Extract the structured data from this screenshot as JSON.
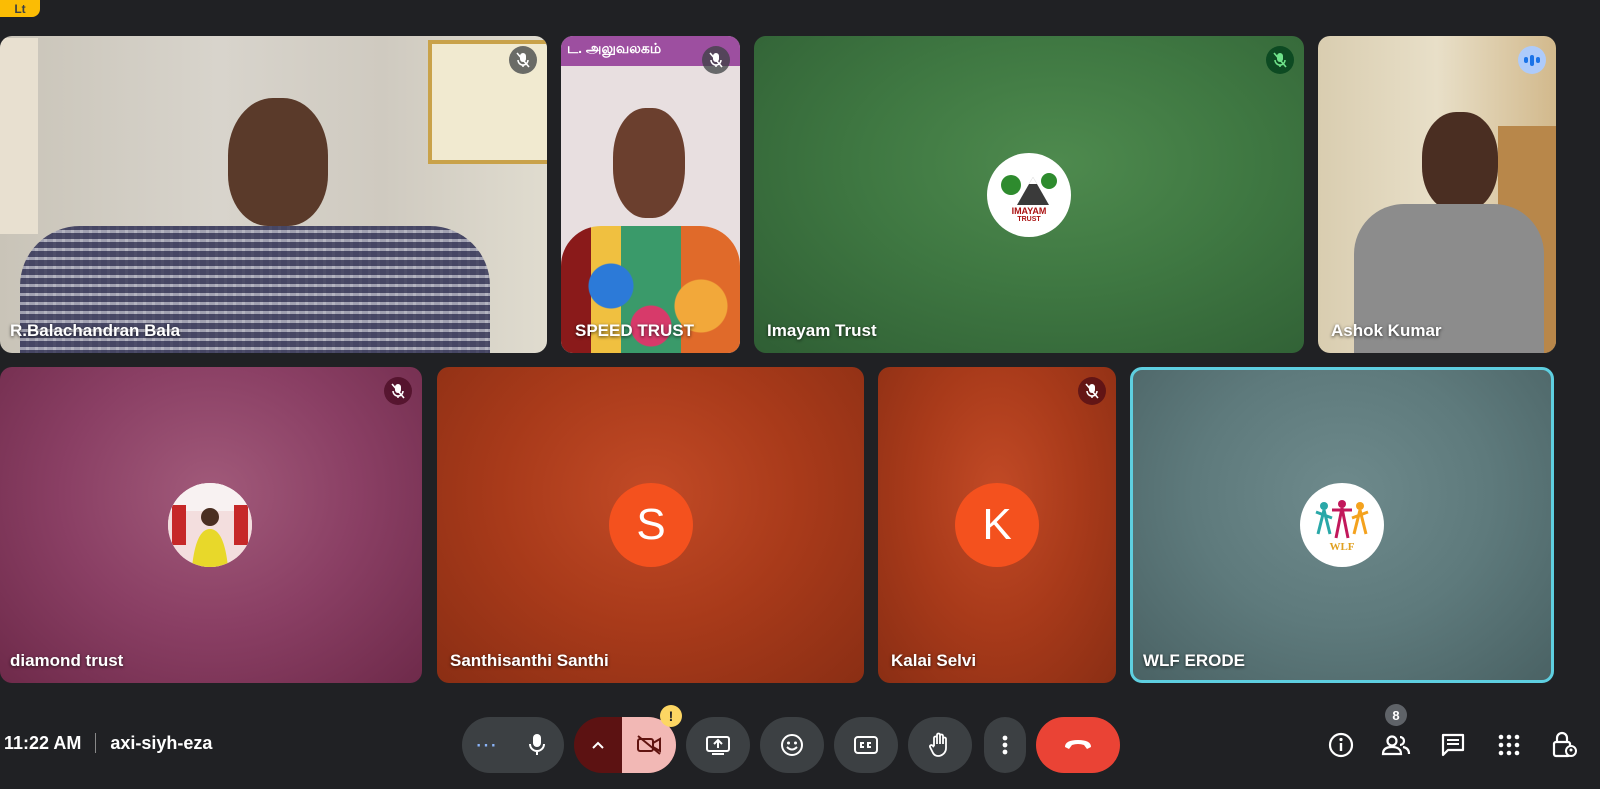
{
  "meeting": {
    "time": "11:22 AM",
    "code": "axi-siyh-eza",
    "participant_count": "8",
    "top_badge": "Lt"
  },
  "tiles": {
    "t1": {
      "name": "R.Balachandran Bala",
      "mic": "muted"
    },
    "t2": {
      "name": "SPEED TRUST",
      "mic": "muted",
      "banner_text": "ட. அலுவலகம்"
    },
    "t3": {
      "name": "Imayam Trust",
      "mic": "muted",
      "logo_text": "IMAYAM",
      "logo_subtext": "TRUST"
    },
    "t4": {
      "name": "Ashok Kumar",
      "mic": "speaking"
    },
    "t5": {
      "name": "diamond trust",
      "mic": "muted"
    },
    "t6": {
      "name": "Santhisanthi Santhi",
      "initial": "S"
    },
    "t7": {
      "name": "Kalai Selvi",
      "mic": "muted",
      "initial": "K"
    },
    "t8": {
      "name": "WLF ERODE",
      "logo_text": "WLF",
      "pinned": true
    }
  },
  "controls": {
    "more_label": "⋯",
    "alert_label": "!"
  },
  "colors": {
    "accent_outline": "#5ecfe0",
    "hangup": "#ea4335",
    "avatar_orange": "#f4511e",
    "alert_yellow": "#fdd663"
  }
}
